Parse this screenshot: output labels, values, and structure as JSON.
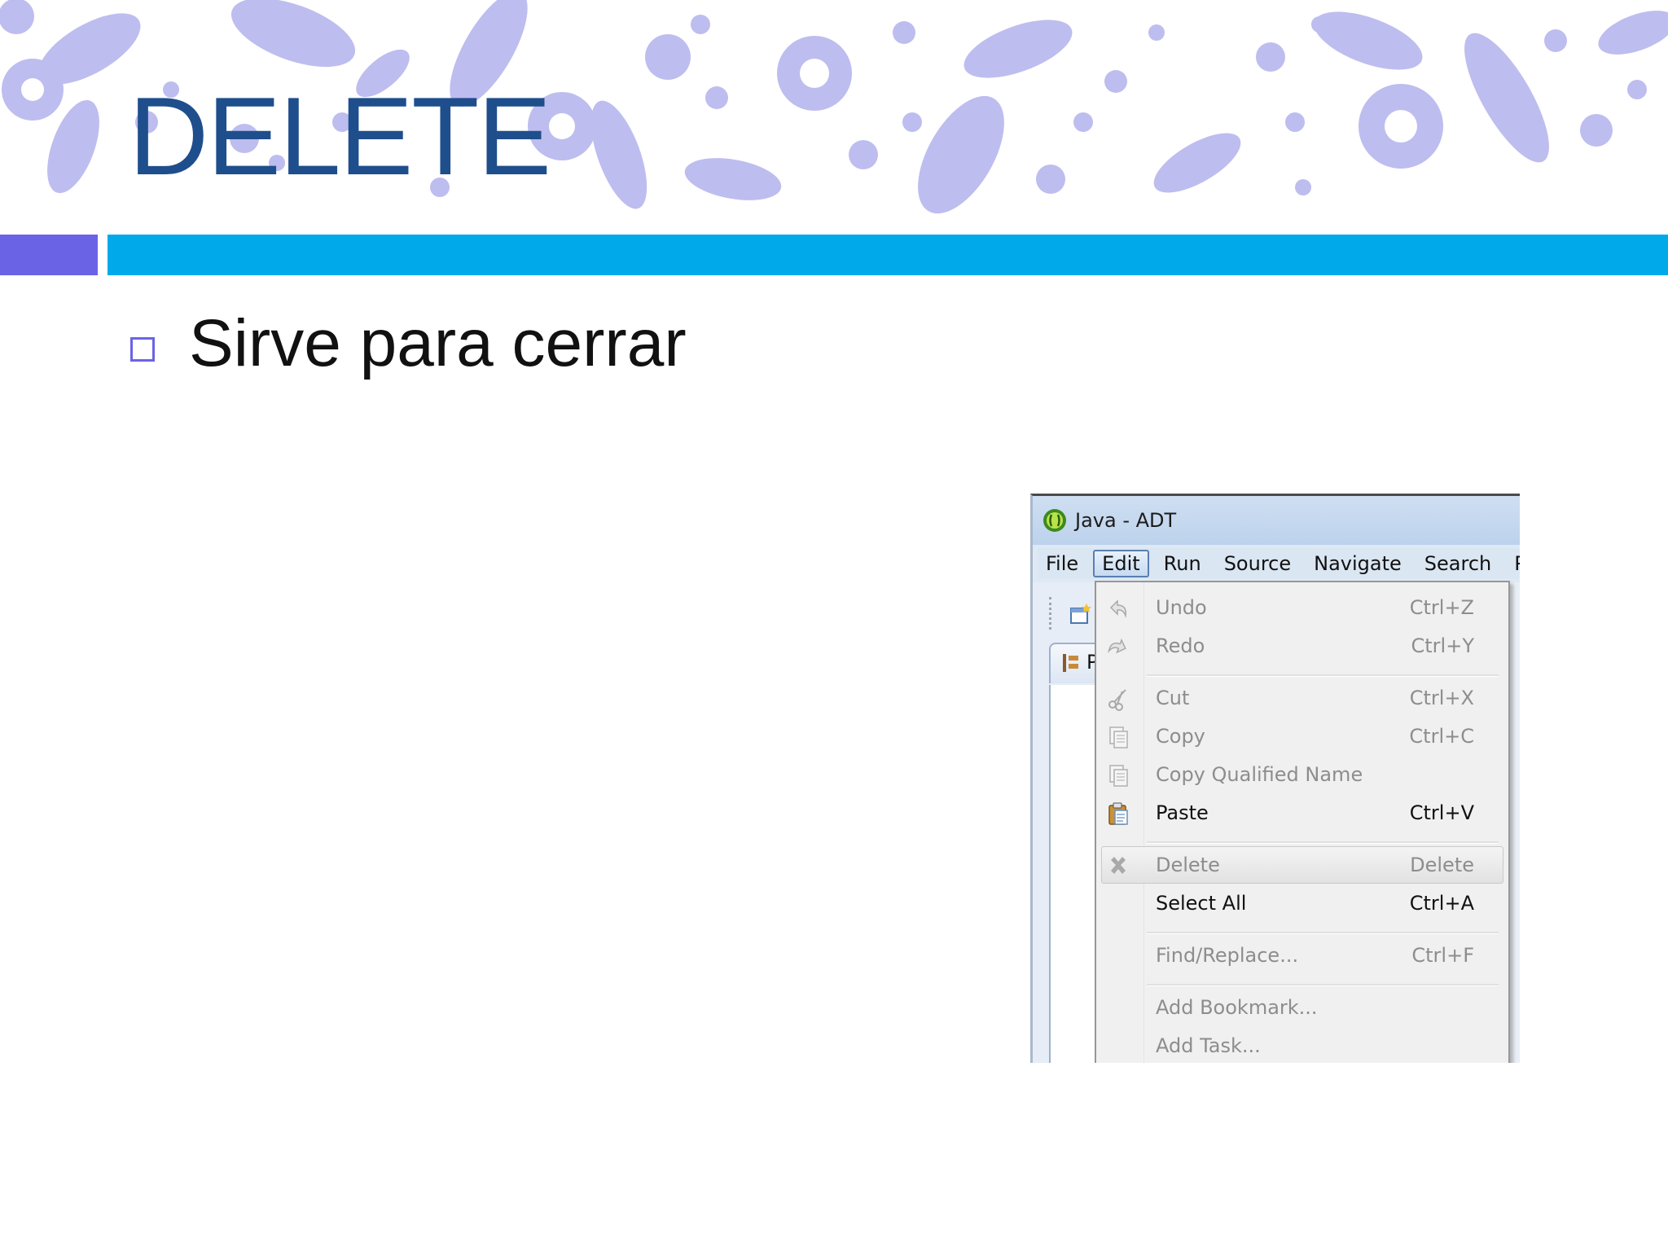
{
  "slide": {
    "title": "DELETE",
    "bullet": "Sirve para cerrar"
  },
  "colors": {
    "title": "#1f4e8c",
    "accent_purple": "#6b63e6",
    "accent_blue": "#00aaea",
    "banner_floral": "#a8a7ea"
  },
  "ide": {
    "window_title": "Java - ADT",
    "app_icon": "eclipse-adt-icon",
    "menubar": [
      "File",
      "Edit",
      "Run",
      "Source",
      "Navigate",
      "Search",
      "P"
    ],
    "active_menu": "Edit",
    "panel_tab_letter": "P",
    "edit_menu": [
      {
        "label": "Undo",
        "shortcut": "Ctrl+Z",
        "icon": "undo-icon",
        "enabled": false
      },
      {
        "label": "Redo",
        "shortcut": "Ctrl+Y",
        "icon": "redo-icon",
        "enabled": false
      },
      {
        "label": "Cut",
        "shortcut": "Ctrl+X",
        "icon": "scissors-icon",
        "enabled": false
      },
      {
        "label": "Copy",
        "shortcut": "Ctrl+C",
        "icon": "copy-icon",
        "enabled": false
      },
      {
        "label": "Copy Qualified Name",
        "shortcut": "",
        "icon": "copy-qualified-icon",
        "enabled": false
      },
      {
        "label": "Paste",
        "shortcut": "Ctrl+V",
        "icon": "paste-icon",
        "enabled": true
      },
      {
        "label": "Delete",
        "shortcut": "Delete",
        "icon": "delete-x-icon",
        "enabled": false,
        "highlighted": true
      },
      {
        "label": "Select All",
        "shortcut": "Ctrl+A",
        "icon": "",
        "enabled": true
      },
      {
        "label": "Find/Replace...",
        "shortcut": "Ctrl+F",
        "icon": "",
        "enabled": false
      },
      {
        "label": "Add Bookmark...",
        "shortcut": "",
        "icon": "",
        "enabled": false
      },
      {
        "label": "Add Task...",
        "shortcut": "",
        "icon": "",
        "enabled": false
      }
    ]
  }
}
